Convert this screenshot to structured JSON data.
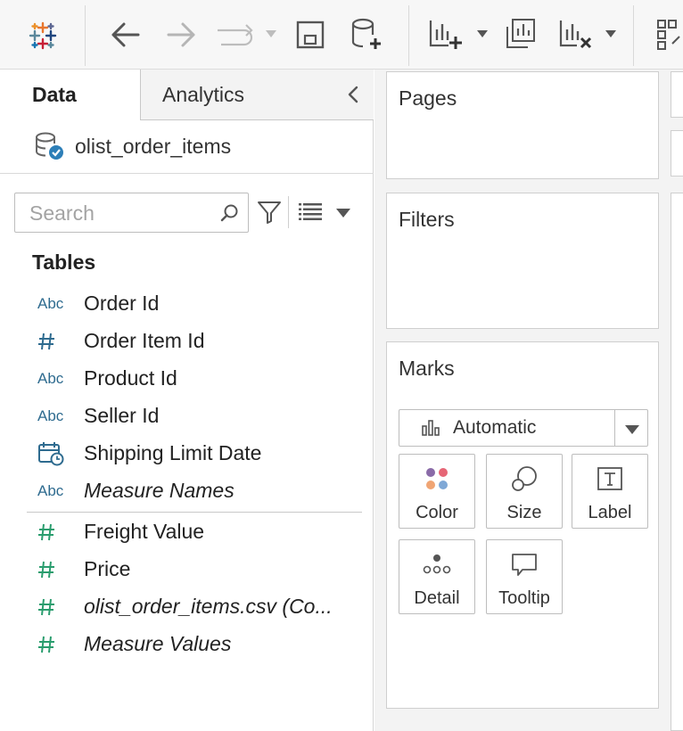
{
  "toolbar": {
    "icons": [
      "tableau-logo-icon",
      "back-icon",
      "forward-icon",
      "redo-icon",
      "save-icon",
      "new-datasource-icon",
      "new-worksheet-icon",
      "duplicate-sheet-icon",
      "clear-sheet-icon",
      "swap-icon"
    ]
  },
  "data_pane": {
    "tabs": [
      {
        "label": "Data",
        "active": true
      },
      {
        "label": "Analytics",
        "active": false
      }
    ],
    "datasource": {
      "name": "olist_order_items"
    },
    "search": {
      "placeholder": "Search",
      "value": ""
    },
    "section_title": "Tables",
    "dimensions": [
      {
        "type_label": "Abc",
        "type": "string",
        "label": "Order Id",
        "italic": false
      },
      {
        "type_label": "#",
        "type": "number",
        "label": "Order Item Id",
        "italic": false
      },
      {
        "type_label": "Abc",
        "type": "string",
        "label": "Product Id",
        "italic": false
      },
      {
        "type_label": "Abc",
        "type": "string",
        "label": "Seller Id",
        "italic": false
      },
      {
        "type_label": "calendar-icon",
        "type": "date",
        "label": "Shipping Limit Date",
        "italic": false
      },
      {
        "type_label": "Abc",
        "type": "string",
        "label": "Measure Names",
        "italic": true
      }
    ],
    "measures": [
      {
        "type_label": "#",
        "type": "number",
        "label": "Freight Value",
        "italic": false
      },
      {
        "type_label": "#",
        "type": "number",
        "label": "Price",
        "italic": false
      },
      {
        "type_label": "#",
        "type": "number",
        "label": "olist_order_items.csv (Co...",
        "italic": true
      },
      {
        "type_label": "#",
        "type": "number",
        "label": "Measure Values",
        "italic": true
      }
    ]
  },
  "shelves": {
    "pages": {
      "title": "Pages"
    },
    "filters": {
      "title": "Filters"
    },
    "marks": {
      "title": "Marks",
      "mark_type": "Automatic",
      "buttons": [
        {
          "label": "Color",
          "icon": "color-icon"
        },
        {
          "label": "Size",
          "icon": "size-icon"
        },
        {
          "label": "Label",
          "icon": "label-icon"
        },
        {
          "label": "Detail",
          "icon": "detail-icon"
        },
        {
          "label": "Tooltip",
          "icon": "tooltip-icon"
        }
      ]
    }
  },
  "colors": {
    "dimension_icon": "#2e6b8f",
    "measure_icon": "#2a9d6e",
    "toolbar_icon": "#555555",
    "disabled_icon": "#b5b5b5"
  }
}
